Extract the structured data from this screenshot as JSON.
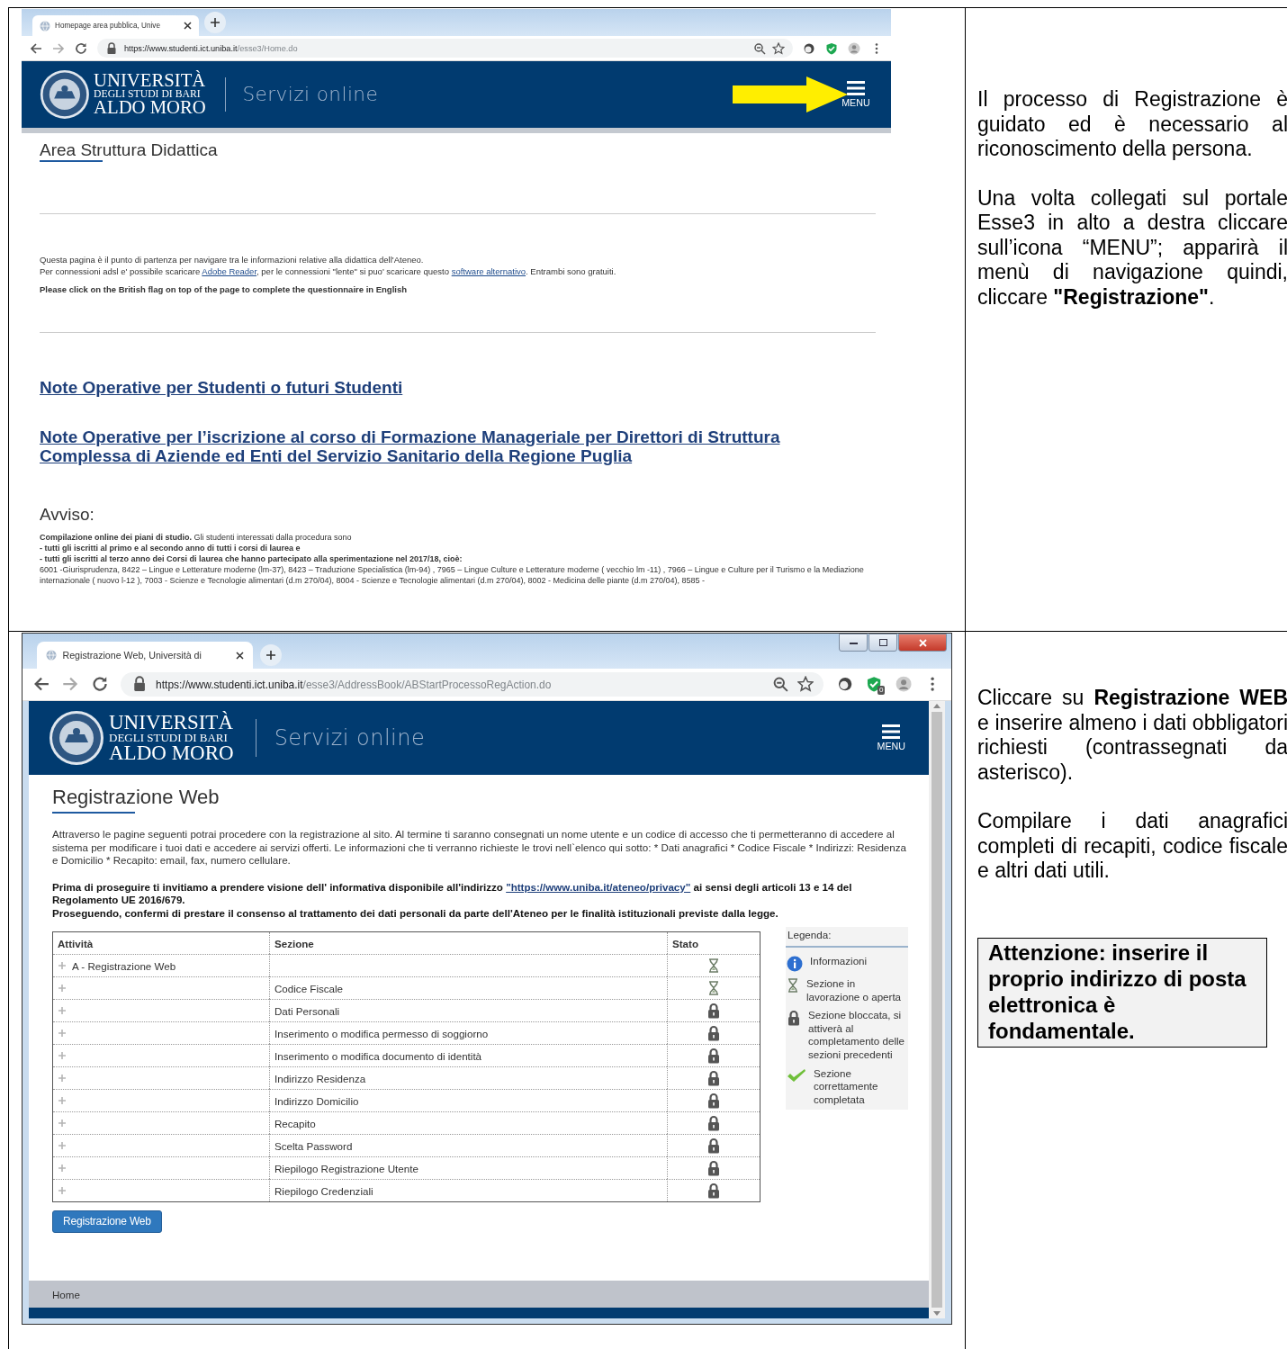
{
  "steps": [
    {
      "browser": {
        "tab_title": "Homepage area pubblica, Unive",
        "url_host": "https://www.studenti.ict.uniba.it",
        "url_path": "/esse3/Home.do",
        "window_controls": false
      },
      "site_header": {
        "university": "UNIVERSITÀ",
        "subtitle": "DEGLI STUDI DI BARI",
        "name": "ALDO MORO",
        "service": "Servizi online",
        "menu_label": "MENU"
      },
      "annotation": {
        "kind": "arrow"
      },
      "content": {
        "kind": "home",
        "title": "Area Struttura Didattica",
        "intro": [
          [
            {
              "text": "Questa pagina è il punto di partenza per navigare tra le informazioni relative alla didattica dell'Ateneo."
            }
          ],
          [
            {
              "text": "Per connessioni adsl e' possibile scaricare "
            },
            {
              "link": "Adobe Reader"
            },
            {
              "text": ", per le connessioni \"lente\" si puo' scaricare questo "
            },
            {
              "link": "software alternativo"
            },
            {
              "text": ". Entrambi sono gratuiti."
            }
          ]
        ],
        "english_notice": "Please click on the British flag on top of the page to complete the questionnaire in English",
        "links": [
          "Note Operative per Studenti o futuri Studenti",
          "Note Operative per l’iscrizione al corso di Formazione Manageriale per Direttori di Struttura Complessa di Aziende ed Enti del Servizio Sanitario della Regione Puglia"
        ],
        "notice_title": "Avviso:",
        "notice": [
          {
            "kind": "lead",
            "text": "**Compilazione online dei piani di studio.** Gli studenti interessati dalla procedura sono"
          },
          {
            "kind": "item",
            "text": "- tutti gli iscritti al primo e al secondo anno di tutti i corsi di laurea e"
          },
          {
            "kind": "item",
            "text": "- tutti gli iscritti al terzo anno dei Corsi di laurea che hanno partecipato alla sperimentazione nel 2017/18, cioè:"
          },
          {
            "kind": "body",
            "text": "6001 -Giurisprudenza, 8422 – Lingue e Letterature moderne (lm-37), 8423 – Traduzione Specialistica (lm-94) , 7965 – Lingue Culture e Letterature moderne ( vecchio lm -11) , 7966 – Lingue e Culture per il Turismo e la Mediazione internazionale ( nuovo l-12 ), 7003 - Scienze e Tecnologie alimentari (d.m 270/04), 8004 - Scienze e Tecnologie alimentari (d.m 270/04), 8002 - Medicina delle piante (d.m 270/04), 8585 -"
          }
        ]
      },
      "note": {
        "paragraphs": [
          "Il processo di Registrazione è guidato ed è necessario al riconoscimento della persona.",
          "Una volta collegati sul portale Esse3 in alto a destra cliccare sull’icona “MENU”; apparirà il menù di navigazione quindi, cliccare **\"Registrazione\"**."
        ]
      }
    },
    {
      "browser": {
        "tab_title": "Registrazione Web, Università di",
        "url_host": "https://www.studenti.ict.uniba.it",
        "url_path": "/esse3/AddressBook/ABStartProcessoRegAction.do",
        "extension_badge": "0",
        "window_controls": true
      },
      "site_header": {
        "university": "UNIVERSITÀ",
        "subtitle": "DEGLI STUDI DI BARI",
        "name": "ALDO MORO",
        "service": "Servizi online",
        "menu_label": "MENU"
      },
      "content": {
        "kind": "registration",
        "title": "Registrazione Web",
        "intro": "Attraverso le pagine seguenti potrai procedere con la registrazione al sito. Al termine ti saranno consegnati un nome utente e un codice di accesso che ti permetteranno di accedere al sistema per modificare i tuoi dati e accedere ai servizi offerti. Le informazioni che ti verranno richieste le trovi nell`elenco qui sotto: * Dati anagrafici * Codice Fiscale * Indirizzi: Residenza e Domicilio * Recapito: email, fax, numero cellulare.",
        "privacy": [
          {
            "text": "Prima di proseguire ti invitiamo a prendere visione dell' informativa disponibile all'indirizzo "
          },
          {
            "link": "\"https://www.uniba.it/ateneo/privacy\""
          },
          {
            "text": " ai sensi degli articoli 13 e 14 del Regolamento UE 2016/679."
          }
        ],
        "consent": "Proseguendo, confermi di prestare il consenso al trattamento dei dati personali da parte dell'Ateneo per le finalità istituzionali previste dalla legge.",
        "table": {
          "columns": [
            "Attività",
            "Sezione",
            "Stato"
          ],
          "rows": [
            {
              "activity": "A - Registrazione Web",
              "kind": "open"
            },
            {
              "section": "Codice Fiscale",
              "kind": "open"
            },
            {
              "section": "Dati Personali",
              "kind": "locked"
            },
            {
              "section": "Inserimento o modifica permesso di soggiorno",
              "kind": "locked"
            },
            {
              "section": "Inserimento o modifica documento di identità",
              "kind": "locked"
            },
            {
              "section": "Indirizzo Residenza",
              "kind": "locked"
            },
            {
              "section": "Indirizzo Domicilio",
              "kind": "locked"
            },
            {
              "section": "Recapito",
              "kind": "locked"
            },
            {
              "section": "Scelta Password",
              "kind": "locked"
            },
            {
              "section": "Riepilogo Registrazione Utente",
              "kind": "locked"
            },
            {
              "section": "Riepilogo Credenziali",
              "kind": "locked"
            }
          ]
        },
        "legend": {
          "title": "Legenda:",
          "items": [
            {
              "kind": "info",
              "text": "Informazioni"
            },
            {
              "kind": "open",
              "text": "Sezione in lavorazione o aperta"
            },
            {
              "kind": "locked",
              "text": "Sezione bloccata, si attiverà al completamento delle sezioni precedenti"
            },
            {
              "kind": "done",
              "text": "Sezione correttamente completata"
            }
          ]
        },
        "button": "Registrazione Web",
        "footer_link": "Home"
      },
      "note": {
        "paragraphs": [
          "Cliccare su **Registrazione WEB** e inserire almeno i dati obbligatori richiesti (contrassegnati da asterisco).",
          "Compilare i dati anagrafici completi di recapiti, codice fiscale e altri dati utili."
        ],
        "warning": "Attenzione: inserire il proprio indirizzo di posta elettronica è fondamentale."
      }
    }
  ]
}
